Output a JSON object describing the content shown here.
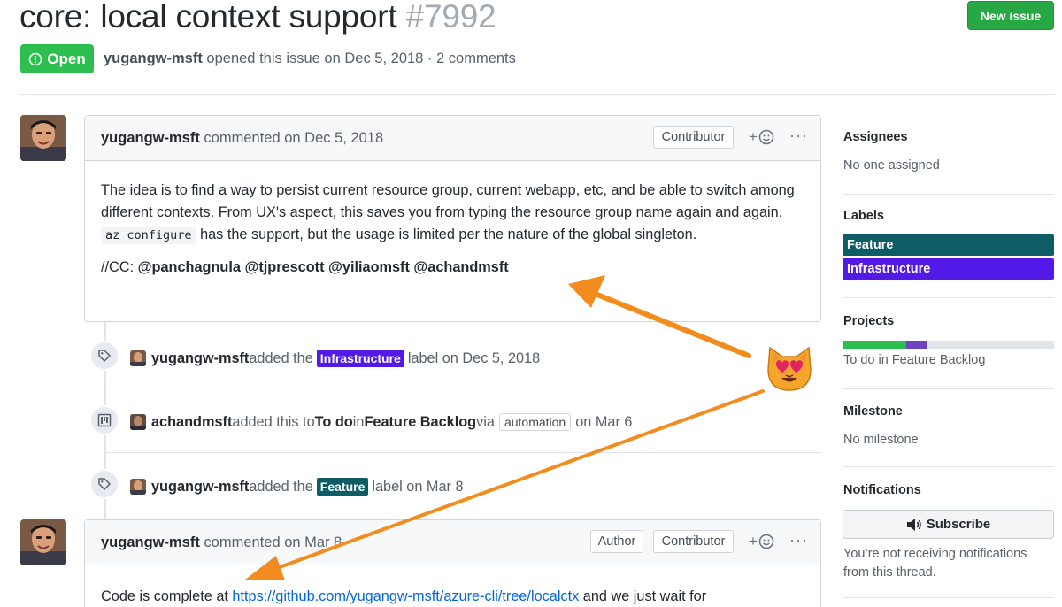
{
  "issue": {
    "title": "core: local context support",
    "number": "#7992",
    "state": "Open",
    "author": "yugangw-msft",
    "meta_rest": " opened this issue on Dec 5, 2018 · 2 comments",
    "new_issue": "New issue"
  },
  "comment1": {
    "author": "yugangw-msft",
    "when": " commented on Dec 5, 2018",
    "badge": "Contributor",
    "react": "+",
    "more": "···",
    "line1": "The idea is to find a way to persist current resource group, current webapp, etc, and be able to switch among different contexts. From UX's aspect, this saves you from typing the resource group name again and again.",
    "code": "az configure",
    "line2": " has the support, but the usage is limited per the nature of the global singleton.",
    "cc_prefix": "//CC: ",
    "mentions": "@panchagnula @tjprescott @yiliaomsft @achandmsft"
  },
  "events": [
    {
      "actor": "yugangw-msft",
      "text1": " added the ",
      "label": "Infrastructure",
      "text2": " label on Dec 5, 2018"
    },
    {
      "actor": "achandmsft",
      "text1": " added this to ",
      "column": "To do",
      "text_in": " in ",
      "project": "Feature Backlog",
      "text_via": " via ",
      "badge": "automation",
      "text2": " on Mar 6"
    },
    {
      "actor": "yugangw-msft",
      "text1": " added the ",
      "label": "Feature",
      "text2": " label on Mar 8"
    }
  ],
  "comment2": {
    "author": "yugangw-msft",
    "when": " commented on Mar 8",
    "badge_author": "Author",
    "badge": "Contributor",
    "react": "+",
    "more": "···",
    "text1": "Code is complete at ",
    "link": "https://github.com/yugangw-msft/azure-cli/tree/localctx",
    "text2": " and we just wait for"
  },
  "sidebar": {
    "assignees_h": "Assignees",
    "assignees_v": "No one assigned",
    "labels_h": "Labels",
    "labels": [
      {
        "name": "Feature",
        "color": "#0e5c66"
      },
      {
        "name": "Infrastructure",
        "color": "#5319e7"
      }
    ],
    "projects_h": "Projects",
    "project_progress": {
      "done": 0.3,
      "in_progress": 0.1
    },
    "project_v": "To do in Feature Backlog",
    "milestone_h": "Milestone",
    "milestone_v": "No milestone",
    "notifications_h": "Notifications",
    "subscribe": "Subscribe",
    "notif_text": "You’re not receiving notifications from this thread."
  },
  "colors": {
    "accent_arrow": "#f28c1e",
    "open_green": "#2cbe4e",
    "link": "#0366d6"
  }
}
